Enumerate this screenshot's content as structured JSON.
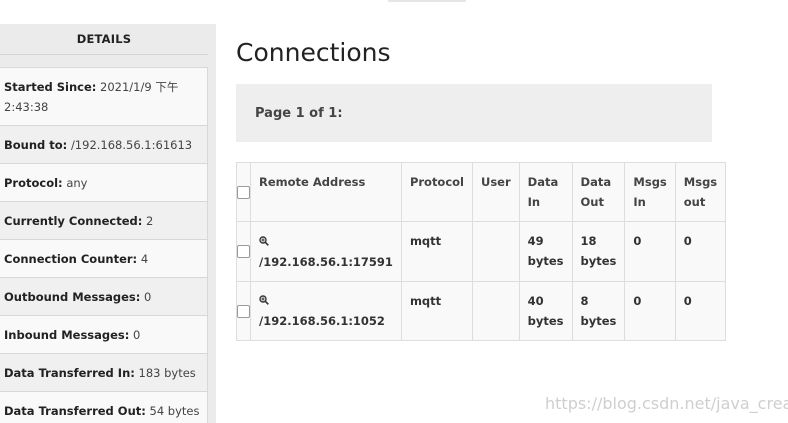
{
  "sidebar": {
    "header": "DETAILS",
    "items": [
      {
        "label": "Started Since:",
        "value": "2021/1/9 下午 2:43:38"
      },
      {
        "label": "Bound to:",
        "value": "/192.168.56.1:61613"
      },
      {
        "label": "Protocol:",
        "value": "any"
      },
      {
        "label": "Currently Connected:",
        "value": "2"
      },
      {
        "label": "Connection Counter:",
        "value": "4"
      },
      {
        "label": "Outbound Messages:",
        "value": "0"
      },
      {
        "label": "Inbound Messages:",
        "value": "0"
      },
      {
        "label": "Data Transferred In:",
        "value": "183 bytes"
      },
      {
        "label": "Data Transferred Out:",
        "value": "54 bytes"
      }
    ]
  },
  "main": {
    "title": "Connections",
    "pager": "Page 1 of 1:",
    "table": {
      "headers": [
        "Remote Address",
        "Protocol",
        "User",
        "Data In",
        "Data Out",
        "Msgs In",
        "Msgs out"
      ],
      "rows": [
        {
          "remote_address": "/192.168.56.1:17591",
          "protocol": "mqtt",
          "user": "",
          "data_in": "49 bytes",
          "data_out": "18 bytes",
          "msgs_in": "0",
          "msgs_out": "0"
        },
        {
          "remote_address": "/192.168.56.1:1052",
          "protocol": "mqtt",
          "user": "",
          "data_in": "40 bytes",
          "data_out": "8 bytes",
          "msgs_in": "0",
          "msgs_out": "0"
        }
      ]
    }
  },
  "icons": {
    "row_action": "zoom-in-icon",
    "select": "checkbox"
  },
  "watermark": "https://blog.csdn.net/java_creater"
}
